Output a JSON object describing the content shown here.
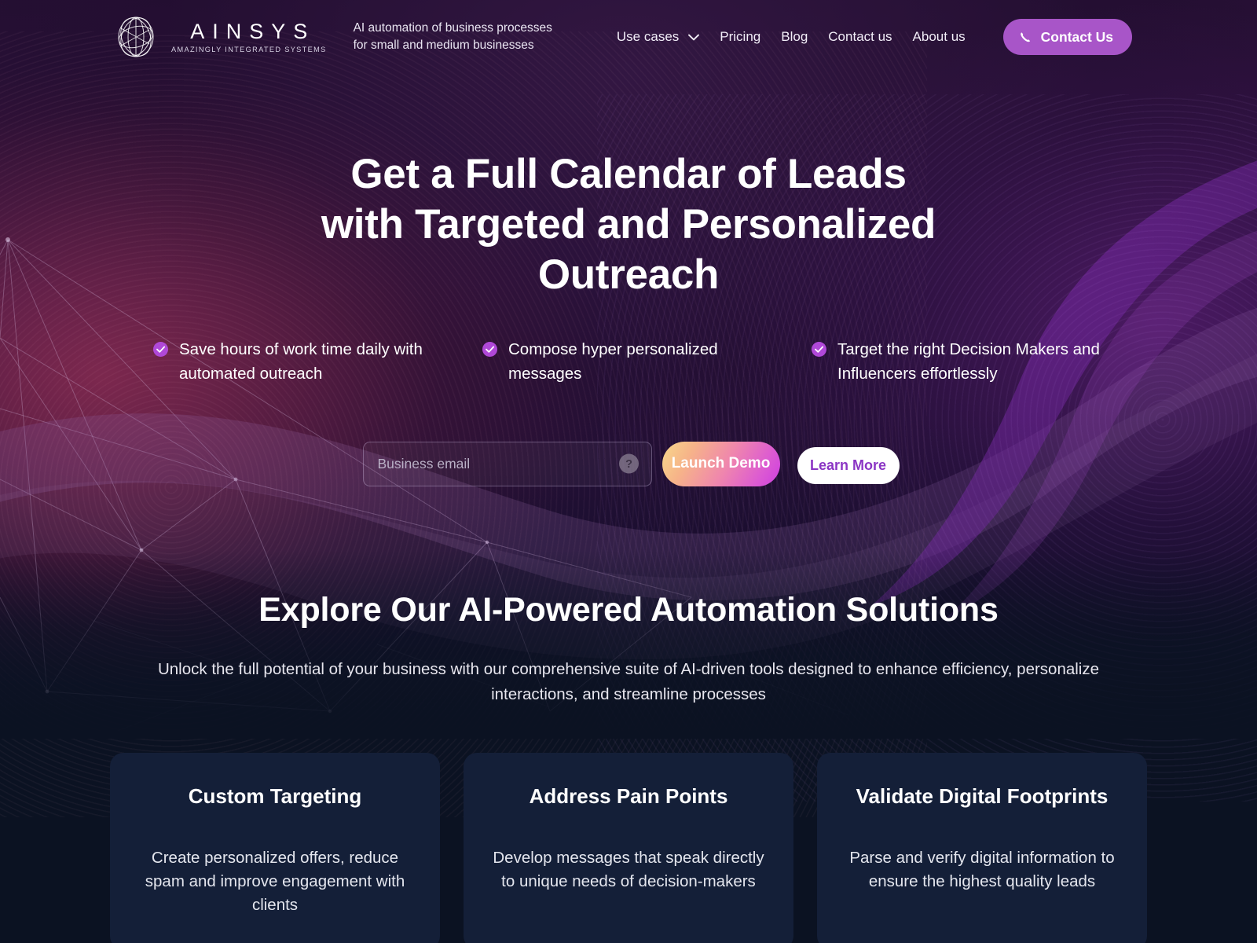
{
  "header": {
    "logo_name": "AINSYS",
    "logo_tagline": "AMAZINGLY INTEGRATED SYSTEMS",
    "logo_icon": "globe-wireframe-icon",
    "tagline_line1": "AI automation of business processes",
    "tagline_line2": "for small and medium businesses",
    "nav": [
      {
        "label": "Use cases",
        "has_dropdown": true
      },
      {
        "label": "Pricing",
        "has_dropdown": false
      },
      {
        "label": "Blog",
        "has_dropdown": false
      },
      {
        "label": "Contact us",
        "has_dropdown": false
      },
      {
        "label": "About us",
        "has_dropdown": false
      }
    ],
    "contact_button": "Contact Us",
    "contact_button_icon": "phone-icon",
    "contact_button_color": "#a855c8"
  },
  "hero": {
    "headline_line1": "Get a Full Calendar of Leads",
    "headline_line2": "with Targeted and Personalized",
    "headline_line3": "Outreach",
    "bullets": [
      {
        "text": "Save hours of work time daily with automated outreach"
      },
      {
        "text": "Compose hyper personalized messages"
      },
      {
        "text": "Target the right Decision Makers and Influencers effortlessly"
      }
    ],
    "bullet_icon": "check-circle-icon",
    "bullet_icon_color": "#b048d8",
    "email_placeholder": "Business email",
    "email_value": "",
    "help_icon": "question-mark-icon",
    "launch_demo_label": "Launch Demo",
    "learn_more_label": "Learn More",
    "learn_more_color": "#8b35c4"
  },
  "solutions": {
    "title": "Explore Our AI-Powered Automation Solutions",
    "subtitle": "Unlock the full potential of your business with our comprehensive suite of AI-driven tools designed to enhance efficiency, personalize interactions, and streamline processes",
    "cards": [
      {
        "title": "Custom Targeting",
        "text": "Create personalized offers, reduce spam and improve engagement with clients"
      },
      {
        "title": "Address Pain Points",
        "text": "Develop messages that speak directly to unique needs of decision-makers"
      },
      {
        "title": "Validate Digital Footprints",
        "text": "Parse and verify digital information to ensure the highest quality leads"
      }
    ],
    "card_background": "#141f38"
  }
}
